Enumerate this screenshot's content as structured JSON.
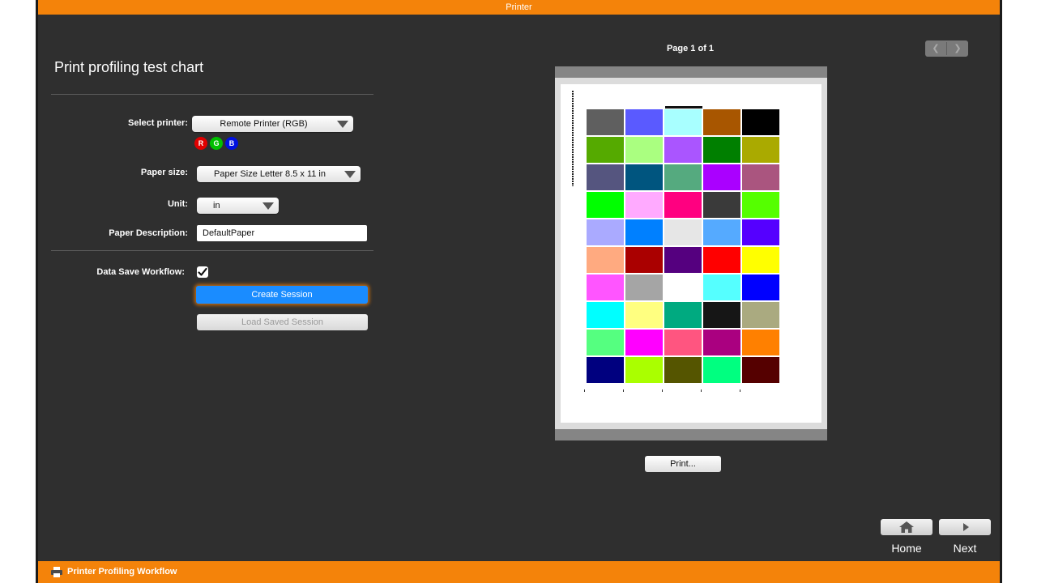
{
  "window": {
    "title": "Printer"
  },
  "page": {
    "title": "Print profiling test chart"
  },
  "form": {
    "select_printer_label": "Select printer:",
    "printer_value": "Remote Printer (RGB)",
    "channels": [
      {
        "label": "R",
        "color": "#e00000"
      },
      {
        "label": "G",
        "color": "#00c000"
      },
      {
        "label": "B",
        "color": "#0010e0"
      }
    ],
    "paper_size_label": "Paper size:",
    "paper_size_value": "Paper Size Letter  8.5 x 11 in",
    "unit_label": "Unit:",
    "unit_value": "in",
    "paper_description_label": "Paper Description:",
    "paper_description_value": "DefaultPaper",
    "data_save_label": "Data Save Workflow:",
    "data_save_checked": true
  },
  "actions": {
    "create_session": "Create Session",
    "load_saved_session": "Load Saved Session",
    "print": "Print..."
  },
  "preview": {
    "page_indicator": "Page 1 of 1",
    "patches": [
      "#5f5f5f",
      "#5a5aff",
      "#a8ffff",
      "#a85600",
      "#000000",
      "#55aa00",
      "#aaff80",
      "#aa55ff",
      "#007f00",
      "#aaaa00",
      "#55557f",
      "#00557f",
      "#55aa7f",
      "#aa00ff",
      "#aa557f",
      "#00ff00",
      "#ffaaff",
      "#ff0080",
      "#3a3a3a",
      "#55ff00",
      "#aaaaff",
      "#0080ff",
      "#e6e6e6",
      "#55aaff",
      "#5500ff",
      "#ffaa80",
      "#aa0000",
      "#55007f",
      "#ff0000",
      "#ffff00",
      "#ff55ff",
      "#a5a5a5",
      "#ffffff",
      "#55ffff",
      "#0000ff",
      "#00ffff",
      "#ffff80",
      "#00aa80",
      "#161616",
      "#aaaa80",
      "#55ff80",
      "#ff00ff",
      "#ff5580",
      "#aa0080",
      "#ff8000",
      "#00007f",
      "#aaff00",
      "#555500",
      "#00ff80",
      "#550000"
    ]
  },
  "navigation": {
    "home": "Home",
    "next": "Next"
  },
  "status_bar": {
    "label": "Printer Profiling Workflow"
  },
  "colors": {
    "accent": "#f4830a",
    "background": "#2f2f2f",
    "primary_button": "#1a8cff"
  }
}
